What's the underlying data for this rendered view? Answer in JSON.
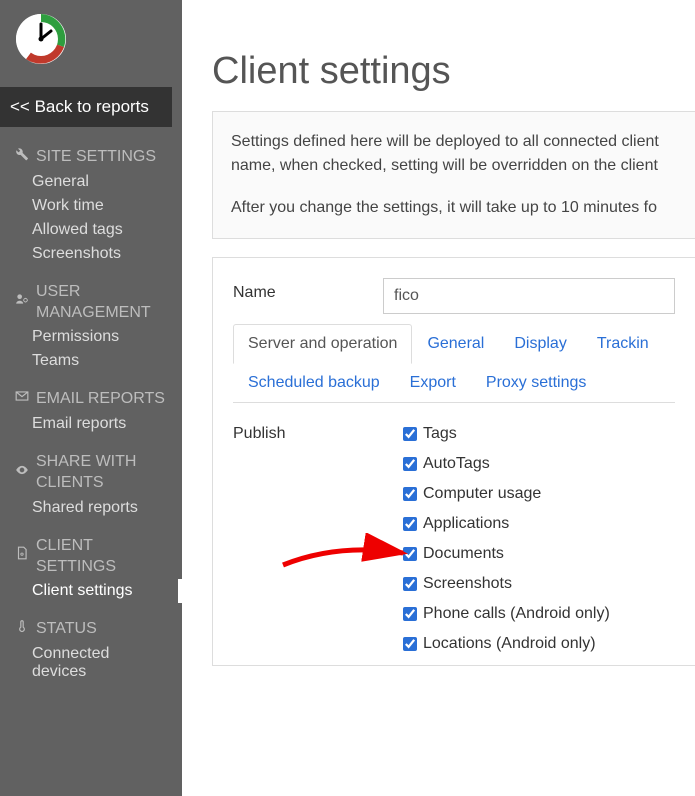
{
  "sidebar": {
    "back_label": "<< Back to reports",
    "sections": [
      {
        "icon": "wrench",
        "title": "SITE SETTINGS",
        "items": [
          "General",
          "Work time",
          "Allowed tags",
          "Screenshots"
        ]
      },
      {
        "icon": "users-cog",
        "title": "USER MANAGEMENT",
        "items": [
          "Permissions",
          "Teams"
        ]
      },
      {
        "icon": "envelope",
        "title": "EMAIL REPORTS",
        "items": [
          "Email reports"
        ]
      },
      {
        "icon": "eye",
        "title": "SHARE WITH CLIENTS",
        "items": [
          "Shared reports"
        ]
      },
      {
        "icon": "file-cog",
        "title": "CLIENT SETTINGS",
        "items": [
          "Client settings"
        ],
        "active_index": 0
      },
      {
        "icon": "thermometer",
        "title": "STATUS",
        "items": [
          "Connected devices"
        ]
      }
    ]
  },
  "page": {
    "title": "Client settings",
    "info_line1": "Settings defined here will be deployed to all connected client",
    "info_line2": "name, when checked, setting will be overridden on the client",
    "info_line3": "After you change the settings, it will take up to 10 minutes fo"
  },
  "form": {
    "name_label": "Name",
    "name_value": "fico",
    "tabs": [
      "Server and operation",
      "General",
      "Display",
      "Trackin",
      "Scheduled backup",
      "Export",
      "Proxy settings"
    ],
    "active_tab": 0,
    "publish_label": "Publish",
    "publish_options": [
      {
        "label": "Tags",
        "checked": true
      },
      {
        "label": "AutoTags",
        "checked": true
      },
      {
        "label": "Computer usage",
        "checked": true
      },
      {
        "label": "Applications",
        "checked": true
      },
      {
        "label": "Documents",
        "checked": true
      },
      {
        "label": "Screenshots",
        "checked": true
      },
      {
        "label": "Phone calls (Android only)",
        "checked": true
      },
      {
        "label": "Locations (Android only)",
        "checked": true
      }
    ]
  }
}
